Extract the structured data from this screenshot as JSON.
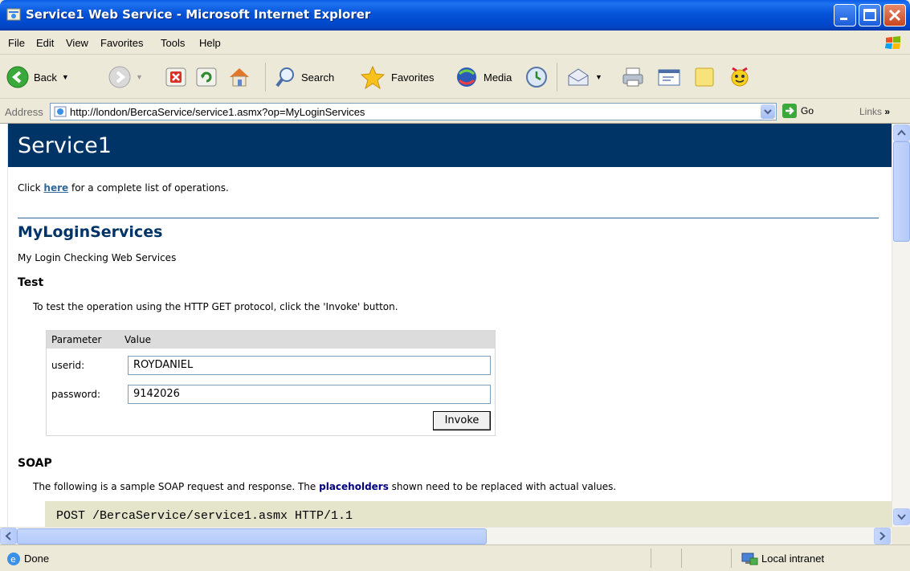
{
  "window": {
    "title": "Service1 Web Service - Microsoft Internet Explorer"
  },
  "menu": [
    "File",
    "Edit",
    "View",
    "Favorites",
    "Tools",
    "Help"
  ],
  "toolbar": {
    "back": "Back",
    "search": "Search",
    "favorites": "Favorites",
    "media": "Media"
  },
  "address": {
    "label": "Address",
    "url": "http://london/BercaService/service1.asmx?op=MyLoginServices",
    "go": "Go",
    "links": "Links"
  },
  "page": {
    "header": "Service1",
    "intro_pre": "Click ",
    "intro_link": "here",
    "intro_post": " for a complete list of operations.",
    "operation": "MyLoginServices",
    "description": "My Login Checking Web Services",
    "test_heading": "Test",
    "test_text": "To test the operation using the HTTP GET protocol, click the 'Invoke' button.",
    "table": {
      "col_param": "Parameter",
      "col_value": "Value",
      "userid_label": "userid:",
      "userid_value": "ROYDANIEL",
      "password_label": "password:",
      "password_value": "9142026",
      "invoke": "Invoke"
    },
    "soap_heading": "SOAP",
    "soap_pre": "The following is a sample SOAP request and response. The ",
    "soap_link": "placeholders",
    "soap_post": " shown need to be replaced with actual values.",
    "code_line": "POST /BercaService/service1.asmx HTTP/1.1"
  },
  "status": {
    "text": "Done",
    "zone": "Local intranet"
  }
}
